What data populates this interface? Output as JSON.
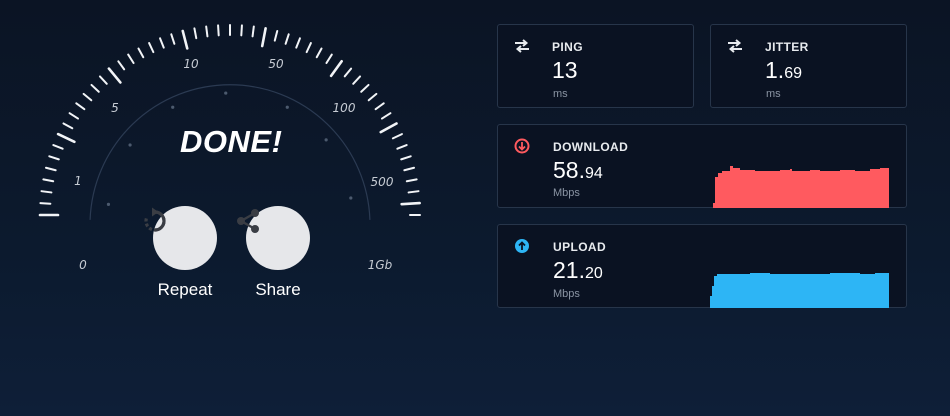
{
  "gauge": {
    "status": "DONE!",
    "scale_labels": [
      "0",
      "1",
      "5",
      "10",
      "50",
      "100",
      "500",
      "1Gb"
    ]
  },
  "actions": {
    "repeat": {
      "label": "Repeat",
      "icon": "repeat-icon"
    },
    "share": {
      "label": "Share",
      "icon": "share-icon"
    }
  },
  "metrics": {
    "ping": {
      "title": "PING",
      "value": "13",
      "decimal": "",
      "unit": "ms",
      "icon": "swap-arrows-icon"
    },
    "jitter": {
      "title": "JITTER",
      "value": "1.",
      "decimal": "69",
      "unit": "ms",
      "icon": "swap-arrows-icon"
    },
    "download": {
      "title": "DOWNLOAD",
      "value": "58.",
      "decimal": "94",
      "unit": "Mbps",
      "icon": "download-arrow-icon",
      "color": "#ff5a5f"
    },
    "upload": {
      "title": "UPLOAD",
      "value": "21.",
      "decimal": "20",
      "unit": "Mbps",
      "icon": "upload-arrow-icon",
      "color": "#2db5f5"
    }
  },
  "colors": {
    "background": "#0c1a2e",
    "card_border": "#27354a",
    "download": "#ff5a5f",
    "upload": "#2db5f5"
  }
}
